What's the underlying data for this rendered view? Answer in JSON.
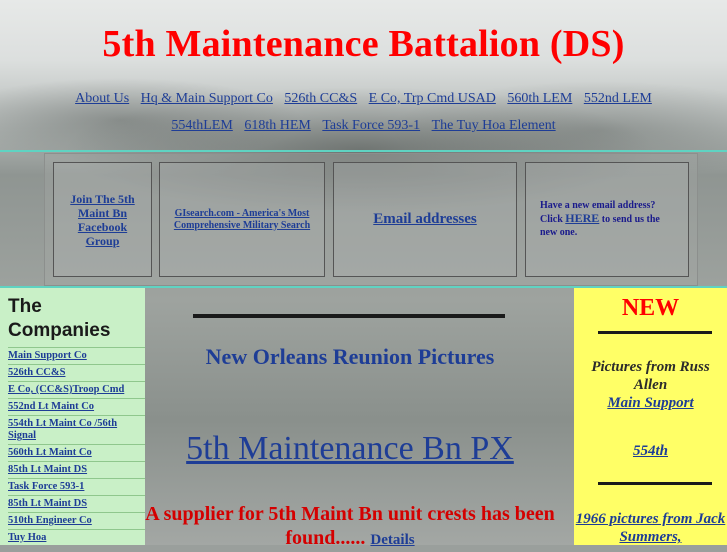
{
  "site_title": "5th Maintenance Battalion (DS)",
  "nav": {
    "row1": [
      "About Us",
      "Hq & Main Support Co",
      "526th CC&S",
      "E Co, Trp Cmd USAD",
      "560th LEM",
      "552nd LEM"
    ],
    "row2": [
      "554thLEM",
      "618th HEM",
      "Task Force 593-1",
      "The Tuy Hoa Element"
    ]
  },
  "feature_boxes": {
    "facebook": "Join The 5th Maint Bn Facebook Group",
    "gisearch": "GIsearch.com - America's Most Comprehensive Military Search",
    "email": "Email addresses",
    "new_email_before": "Have a new email address? Click ",
    "new_email_link": "HERE",
    "new_email_after": " to send us the new one."
  },
  "companies": {
    "title": "The Companies",
    "items": [
      "Main Support Co",
      "526th CC&S",
      "E Co, (CC&S)Troop Cmd",
      "552nd Lt Maint Co",
      "554th Lt Maint Co /56th Signal",
      "560th Lt Maint Co",
      "85th Lt Maint DS",
      "Task Force 593-1",
      "85th Lt Maint DS",
      "510th Engineer Co",
      "Tuy Hoa"
    ]
  },
  "center": {
    "reunion": "New Orleans Reunion Pictures",
    "px": "5th Maintenance Bn PX",
    "supplier": "A supplier for 5th Maint Bn unit crests has been found......",
    "details": "Details"
  },
  "right": {
    "new": "NEW",
    "pictures_from": "Pictures from Russ Allen",
    "main_support": "Main Support",
    "554th": "554th",
    "pics_1966": "1966 pictures from Jack Summers,"
  },
  "colors": {
    "title_red": "#ff0000",
    "link_blue": "#1e3d96",
    "left_panel": "#c9f0c7",
    "right_panel": "#ffff66",
    "rule_teal": "#5fd3c2"
  }
}
